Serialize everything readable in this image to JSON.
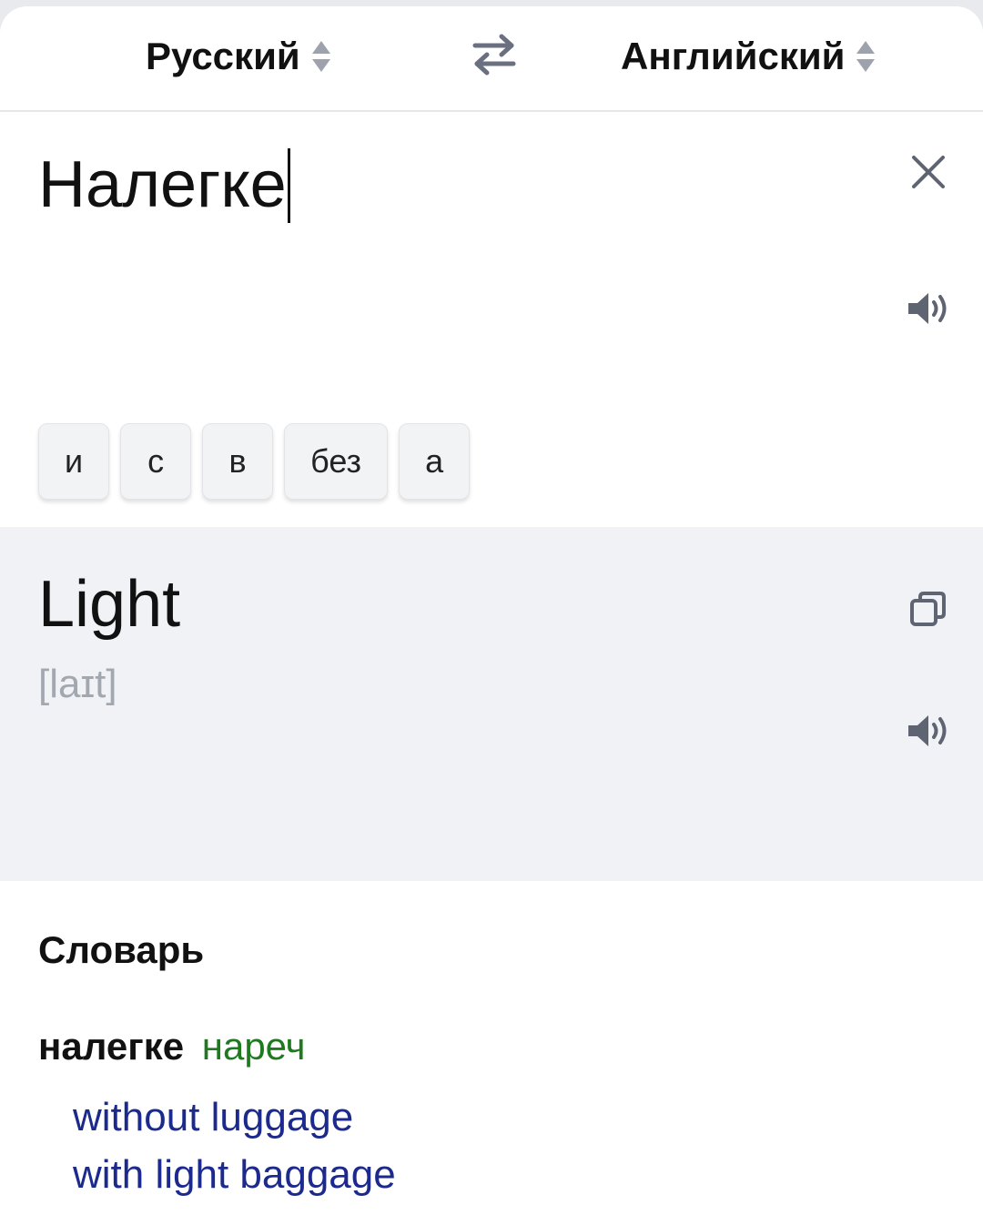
{
  "header": {
    "source_lang": "Русский",
    "target_lang": "Английский",
    "swap_icon": "swap-arrows-icon",
    "selector_icon": "up-down-caret-icon"
  },
  "input": {
    "text": "Налегке",
    "clear_icon": "close-icon",
    "speaker_icon": "speaker-icon"
  },
  "suggestions": [
    "и",
    "с",
    "в",
    "без",
    "а"
  ],
  "output": {
    "text": "Light",
    "transcription": "[laɪt]",
    "copy_icon": "copy-icon",
    "speaker_icon": "speaker-icon"
  },
  "dictionary": {
    "title": "Словарь",
    "word": "налегке",
    "pos": "нареч",
    "translations": [
      "without luggage",
      "with light baggage"
    ]
  },
  "colors": {
    "accent_pos": "#1f7a1f",
    "translation_link": "#1b2a8c",
    "output_bg": "#f0f2f5",
    "icon_gray": "#6b7080"
  }
}
